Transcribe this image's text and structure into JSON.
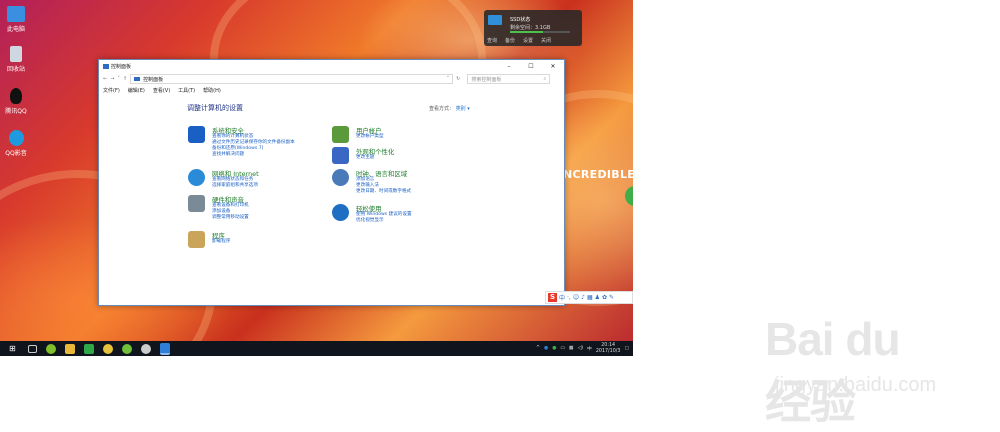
{
  "desktop": {
    "icons": [
      {
        "label": "此电脑",
        "color": "#3a8fe0"
      },
      {
        "label": "回收站",
        "color": "#cfd8e0"
      },
      {
        "label": "腾讯QQ",
        "color": "#111111"
      },
      {
        "label": "QQ影音",
        "color": "#1e9be0"
      }
    ],
    "wallpaper_text": "NCREDIBLE"
  },
  "widget": {
    "line1": "SSD状态",
    "line2": "剩余空间：3.1GB",
    "usage_fraction": 0.55,
    "actions": [
      "查询",
      "备份",
      "设置",
      "关闭"
    ]
  },
  "window": {
    "title": "控制面板",
    "controls": [
      "–",
      "☐",
      "✕"
    ],
    "address_path": "控制面板",
    "search_placeholder": "搜索控制面板",
    "menu": [
      "文件(F)",
      "编辑(E)",
      "查看(V)",
      "工具(T)",
      "帮助(H)"
    ],
    "heading": "调整计算机的设置",
    "view_by_label": "查看方式：",
    "view_by_value": "类别 ▾",
    "categories_left": [
      {
        "title": "系统和安全",
        "links": [
          "查看你的计算机状态",
          "通过文件历史记录保存你的文件备份副本",
          "备份和还原(Windows 7)",
          "查找并解决问题"
        ],
        "color": "#1a5fc4"
      },
      {
        "title": "网络和 Internet",
        "links": [
          "查看网络状态和任务",
          "选择家庭组和共享选项"
        ],
        "color": "#2a8bd8"
      },
      {
        "title": "硬件和声音",
        "links": [
          "查看设备和打印机",
          "添加设备",
          "调整常用移动设置"
        ],
        "color": "#7a8a96"
      },
      {
        "title": "程序",
        "links": [
          "卸载程序"
        ],
        "color": "#c9a45a"
      }
    ],
    "categories_right": [
      {
        "title": "用户帐户",
        "links": [
          "更改帐户类型"
        ],
        "color": "#5a9a3a"
      },
      {
        "title": "外观和个性化",
        "links": [
          "更改主题"
        ],
        "color": "#3a66c4"
      },
      {
        "title": "时钟、语言和区域",
        "links": [
          "添加语言",
          "更改输入法",
          "更改日期、时间或数字格式"
        ],
        "color": "#4a7ab8"
      },
      {
        "title": "轻松使用",
        "links": [
          "使用 Windows 建议的设置",
          "优化视觉显示"
        ],
        "color": "#1e6fc4"
      }
    ]
  },
  "ime": {
    "logo": "S",
    "mode": "中"
  },
  "taskbar": {
    "apps": [
      "#2a7fd4",
      "#7fbf2a",
      "#e8b83a",
      "#2fa84a",
      "#e8c23a",
      "#6fbf3a",
      "#cccccc",
      "#2f7fd8"
    ],
    "time": "20:14",
    "date": "2017/10/3",
    "lang": "中"
  },
  "watermark": {
    "logo": "Bai du 经验",
    "url": "jingyan.baidu.com"
  }
}
